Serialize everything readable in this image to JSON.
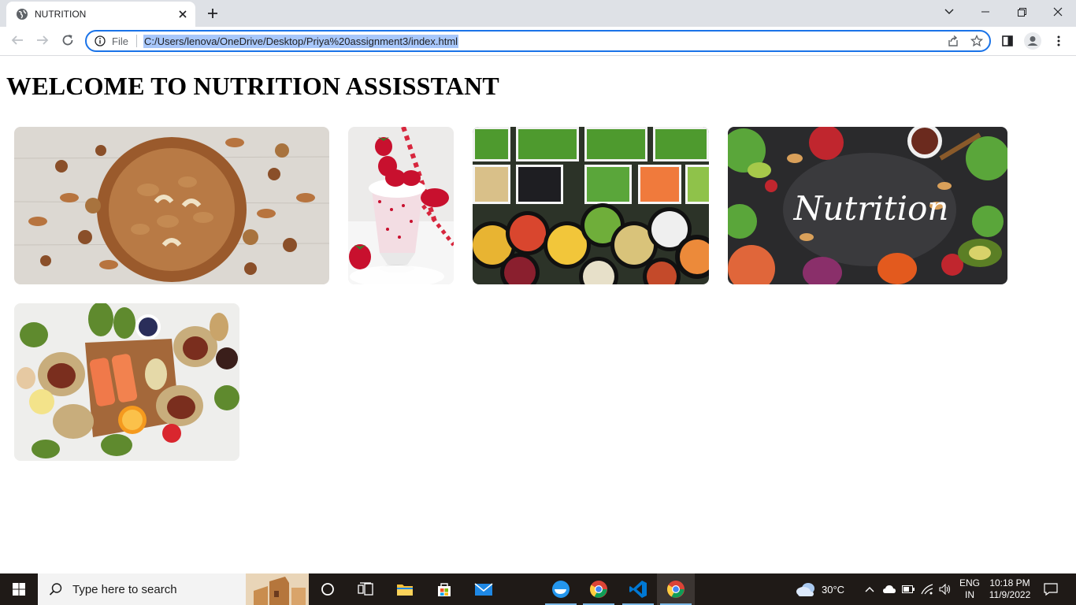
{
  "browser": {
    "tab_title": "NUTRITION",
    "address_scheme": "File",
    "address_url": "C:/Users/lenova/OneDrive/Desktop/Priya%20assignment3/index.html"
  },
  "page": {
    "heading": "WELCOME TO NUTRITION ASSISSTANT",
    "images": [
      {
        "name": "nuts-bowl-image",
        "alt": "bowl of mixed nuts"
      },
      {
        "name": "strawberry-milkshake-image",
        "alt": "strawberry milkshake"
      },
      {
        "name": "salad-bar-image",
        "alt": "salad bar bowls"
      },
      {
        "name": "nutrition-board-image",
        "alt": "vegetables around chalkboard",
        "overlay_text": "Nutrition"
      },
      {
        "name": "healthy-foods-image",
        "alt": "salmon, nuts and vegetables"
      }
    ]
  },
  "taskbar": {
    "search_placeholder": "Type here to search",
    "weather": "30°C",
    "language_line1": "ENG",
    "language_line2": "IN",
    "time": "10:18 PM",
    "date": "11/9/2022"
  },
  "colors": {
    "accent": "#1a73e8",
    "tabstrip": "#dee1e6",
    "taskbar": "#1f1a17"
  }
}
